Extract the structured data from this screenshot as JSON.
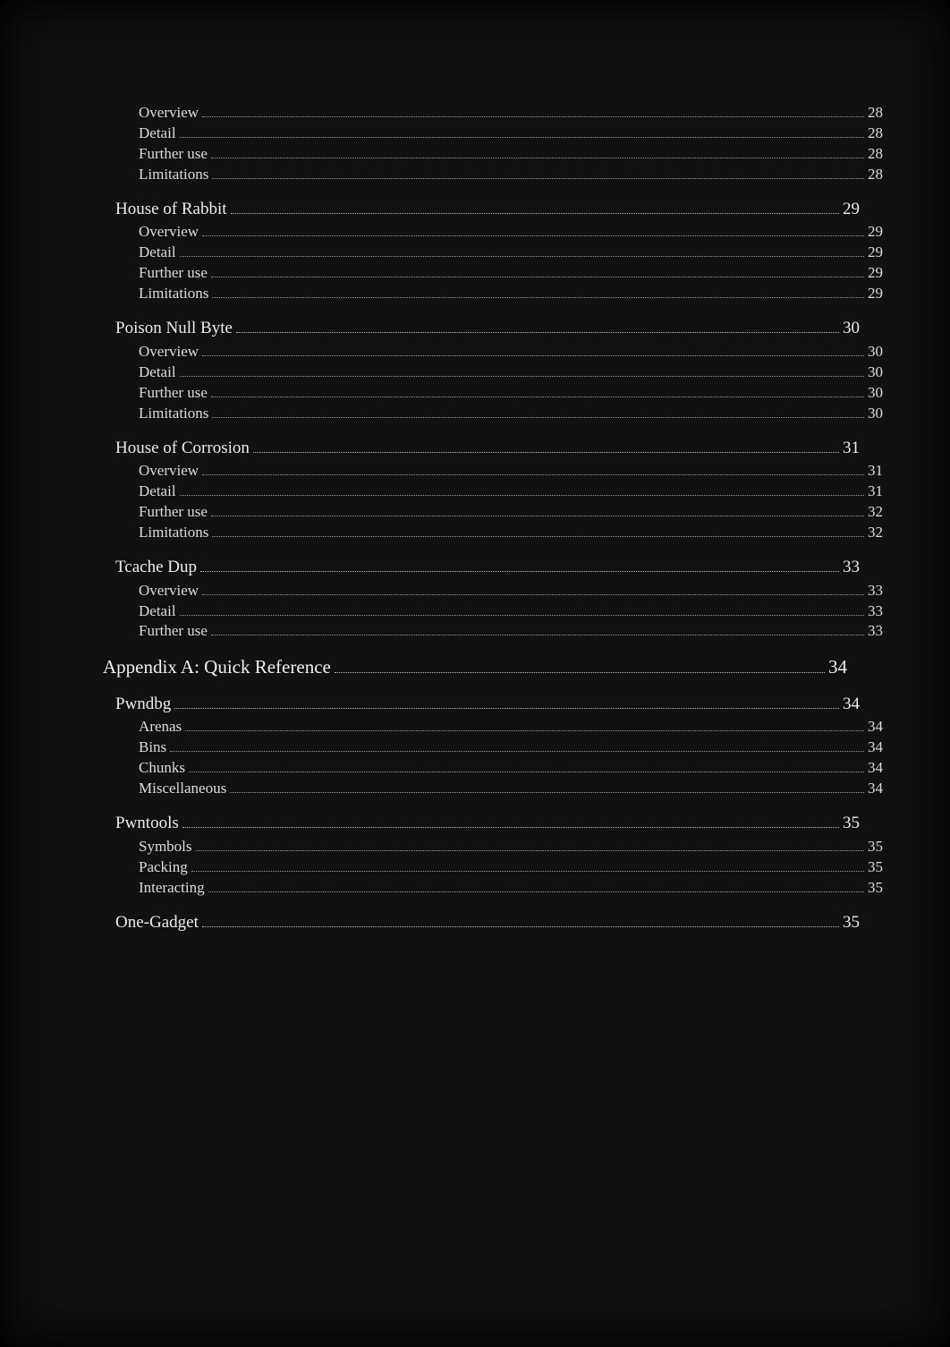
{
  "toc": [
    {
      "level": 3,
      "title": "Overview",
      "page": "28",
      "first": true
    },
    {
      "level": 3,
      "title": "Detail",
      "page": "28"
    },
    {
      "level": 3,
      "title": "Further use",
      "page": "28"
    },
    {
      "level": 3,
      "title": "Limitations",
      "page": "28"
    },
    {
      "level": 2,
      "title": "House of Rabbit",
      "page": "29"
    },
    {
      "level": 3,
      "title": "Overview",
      "page": "29"
    },
    {
      "level": 3,
      "title": "Detail",
      "page": "29"
    },
    {
      "level": 3,
      "title": "Further use",
      "page": "29"
    },
    {
      "level": 3,
      "title": "Limitations",
      "page": "29"
    },
    {
      "level": 2,
      "title": "Poison Null Byte",
      "page": "30"
    },
    {
      "level": 3,
      "title": "Overview",
      "page": "30"
    },
    {
      "level": 3,
      "title": "Detail",
      "page": "30"
    },
    {
      "level": 3,
      "title": "Further use",
      "page": "30"
    },
    {
      "level": 3,
      "title": "Limitations",
      "page": "30"
    },
    {
      "level": 2,
      "title": "House of Corrosion",
      "page": "31"
    },
    {
      "level": 3,
      "title": "Overview",
      "page": "31"
    },
    {
      "level": 3,
      "title": "Detail",
      "page": "31"
    },
    {
      "level": 3,
      "title": "Further use",
      "page": "32"
    },
    {
      "level": 3,
      "title": "Limitations",
      "page": "32"
    },
    {
      "level": 2,
      "title": "Tcache Dup",
      "page": "33"
    },
    {
      "level": 3,
      "title": "Overview",
      "page": "33"
    },
    {
      "level": 3,
      "title": "Detail",
      "page": "33"
    },
    {
      "level": 3,
      "title": "Further use",
      "page": "33"
    },
    {
      "level": 1,
      "title": "Appendix A: Quick Reference",
      "page": "34"
    },
    {
      "level": 2,
      "title": "Pwndbg",
      "page": "34"
    },
    {
      "level": 3,
      "title": "Arenas",
      "page": "34"
    },
    {
      "level": 3,
      "title": "Bins",
      "page": "34"
    },
    {
      "level": 3,
      "title": "Chunks",
      "page": "34"
    },
    {
      "level": 3,
      "title": "Miscellaneous",
      "page": "34"
    },
    {
      "level": 2,
      "title": "Pwntools",
      "page": "35"
    },
    {
      "level": 3,
      "title": "Symbols",
      "page": "35"
    },
    {
      "level": 3,
      "title": "Packing",
      "page": "35"
    },
    {
      "level": 3,
      "title": "Interacting",
      "page": "35"
    },
    {
      "level": 2,
      "title": "One-Gadget",
      "page": "35"
    }
  ]
}
